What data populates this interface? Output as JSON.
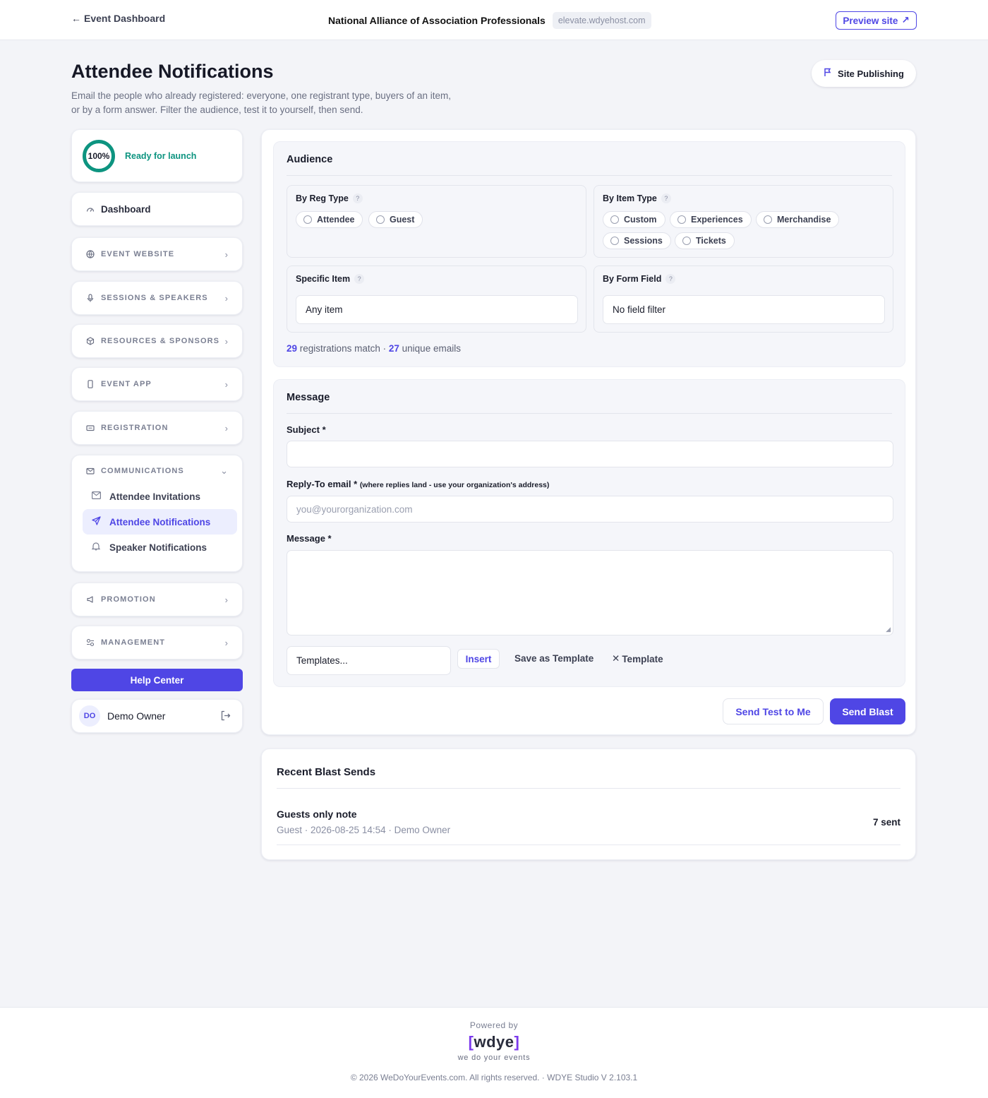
{
  "topbar": {
    "back_label": "Event Dashboard",
    "org_name": "National Alliance of Association Professionals",
    "domain": "elevate.wdyehost.com",
    "preview_label": "Preview site"
  },
  "header": {
    "title": "Attendee Notifications",
    "description_line1": "Email the people who already registered: everyone, one registrant type, buyers of an item,",
    "description_line2": "or by a form answer. Filter the audience, test it to yourself, then send.",
    "publish_label": "Site Publishing"
  },
  "sidebar": {
    "launch_percent": "100%",
    "launch_status": "Ready for launch",
    "dashboard_label": "Dashboard",
    "sections": [
      {
        "label": "EVENT WEBSITE",
        "icon": "globe-icon"
      },
      {
        "label": "SESSIONS & SPEAKERS",
        "icon": "microphone-icon"
      },
      {
        "label": "RESOURCES & SPONSORS",
        "icon": "box-icon"
      },
      {
        "label": "EVENT APP",
        "icon": "phone-icon"
      },
      {
        "label": "REGISTRATION",
        "icon": "ticket-icon"
      }
    ],
    "communications": {
      "label": "COMMUNICATIONS",
      "items": [
        {
          "label": "Attendee Invitations",
          "icon": "mail-icon"
        },
        {
          "label": "Attendee Notifications",
          "icon": "send-icon",
          "active": true
        },
        {
          "label": "Speaker Notifications",
          "icon": "bell-icon"
        }
      ]
    },
    "promotion_label": "PROMOTION",
    "management_label": "MANAGEMENT",
    "help_label": "Help Center",
    "user": {
      "initials": "DO",
      "name": "Demo Owner"
    }
  },
  "audience": {
    "title": "Audience",
    "reg_type": {
      "title": "By Reg Type",
      "options": [
        "Attendee",
        "Guest"
      ]
    },
    "item_type": {
      "title": "By Item Type",
      "options": [
        "Custom",
        "Experiences",
        "Merchandise",
        "Sessions",
        "Tickets"
      ]
    },
    "specific_item": {
      "title": "Specific Item",
      "value": "Any item"
    },
    "form_field": {
      "title": "By Form Field",
      "value": "No field filter"
    },
    "match_count": "29",
    "match_text": "registrations match ·",
    "unique_count": "27",
    "unique_text": "unique emails"
  },
  "message": {
    "title": "Message",
    "subject_label": "Subject *",
    "subject_value": "",
    "reply_label": "Reply-To email *",
    "reply_hint": "(where replies land - use your organization's address)",
    "reply_placeholder": "you@yourorganization.com",
    "message_label": "Message *",
    "templates_placeholder": "Templates...",
    "insert_label": "Insert",
    "save_template_label": "Save as Template",
    "delete_template_label": "Template"
  },
  "actions": {
    "send_test_label": "Send Test to Me",
    "send_blast_label": "Send Blast"
  },
  "recent": {
    "title": "Recent Blast Sends",
    "rows": [
      {
        "title": "Guests only note",
        "meta": "Guest · 2026-08-25 14:54 · Demo Owner",
        "count": "7 sent"
      }
    ]
  },
  "footer": {
    "powered_by": "Powered by",
    "logo_open": "[",
    "logo_text": "wdye",
    "logo_close": "]",
    "tagline": "we do your events",
    "copyright": "© 2026 WeDoYourEvents.com. All rights reserved. · WDYE Studio V 2.103.1"
  },
  "colors": {
    "accent": "#4f46e5",
    "success": "#0d9480",
    "background": "#f3f4f8"
  }
}
